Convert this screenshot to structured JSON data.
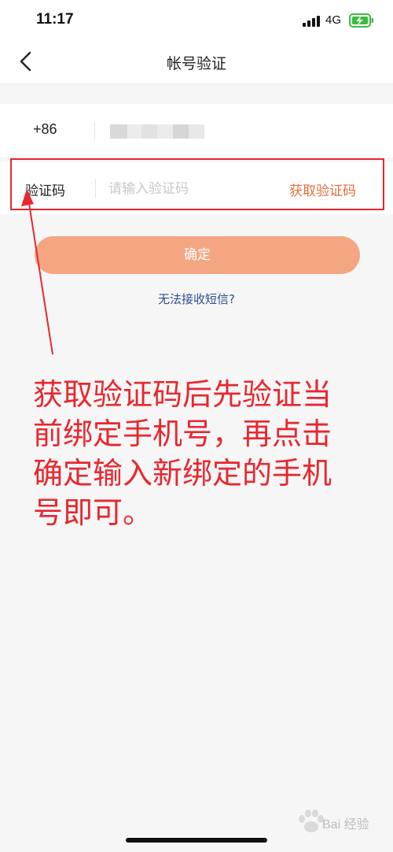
{
  "status_bar": {
    "time": "11:17",
    "network": "4G",
    "signal_icon": "signal-bars-icon",
    "battery_icon": "battery-charging-icon",
    "battery_color": "#3dbb3d"
  },
  "nav": {
    "title": "帐号验证",
    "back_icon": "chevron-left-icon"
  },
  "phone_row": {
    "country_code": "+86"
  },
  "code_row": {
    "label": "验证码",
    "placeholder": "请输入验证码",
    "get_code_label": "获取验证码"
  },
  "confirm_label": "确定",
  "help_link": "无法接收短信?",
  "annotation": {
    "lines": [
      "获取验证码后先验证当",
      "前绑定手机号，再点击",
      "确定输入新绑定的手机",
      "号即可。"
    ]
  },
  "watermark": {
    "text": "Bai 经验"
  },
  "colors": {
    "accent": "#e0703c",
    "button": "#f4a683",
    "annotation": "#e8272e",
    "link": "#2d4f8e"
  }
}
